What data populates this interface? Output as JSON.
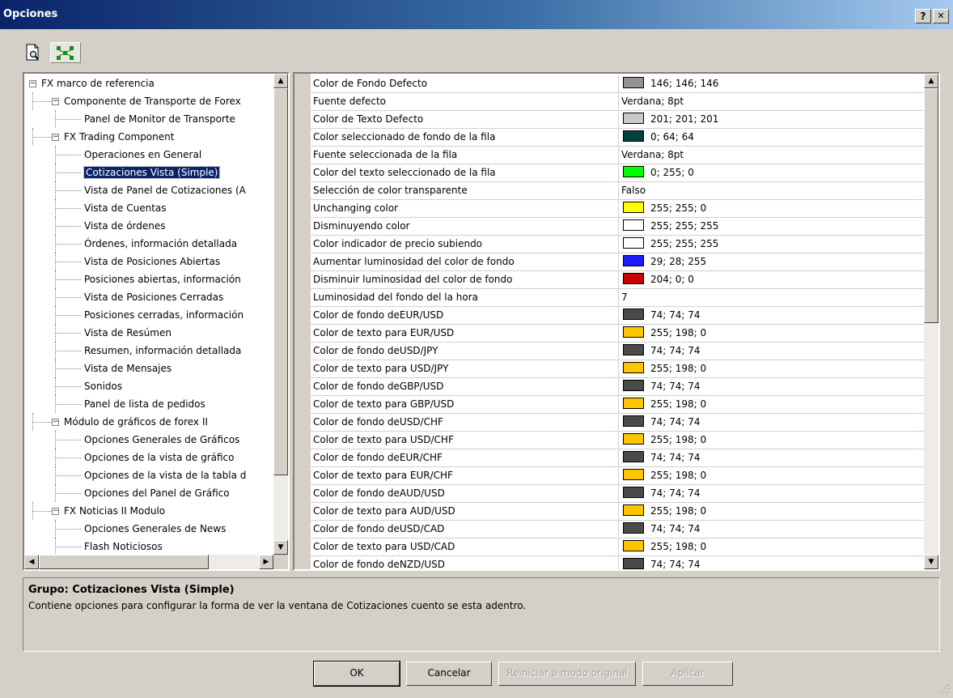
{
  "window": {
    "title": "Opciones",
    "help_btn": "?",
    "close_btn": "✕"
  },
  "tree": {
    "items": [
      {
        "label": "FX  marco de referencia",
        "level": 0,
        "expander": "−"
      },
      {
        "label": "Componente de Transporte de Forex",
        "level": 1,
        "expander": "−"
      },
      {
        "label": "Panel de Monitor de Transporte",
        "level": 2
      },
      {
        "label": "FX Trading Component",
        "level": 1,
        "expander": "−"
      },
      {
        "label": "Operaciones en General",
        "level": 2
      },
      {
        "label": "Cotizaciones Vista (Simple)",
        "level": 2,
        "selected": true
      },
      {
        "label": "Vista de Panel de Cotizaciones (A",
        "level": 2
      },
      {
        "label": "Vista de Cuentas",
        "level": 2
      },
      {
        "label": "Vista de órdenes",
        "level": 2
      },
      {
        "label": "Órdenes, información detallada",
        "level": 2
      },
      {
        "label": "Vista de Posiciones Abiertas",
        "level": 2
      },
      {
        "label": "Posiciones abiertas, información",
        "level": 2
      },
      {
        "label": "Vista de Posiciones Cerradas",
        "level": 2
      },
      {
        "label": "Posiciones cerradas, información",
        "level": 2
      },
      {
        "label": "Vista de Resúmen",
        "level": 2
      },
      {
        "label": "Resumen, información detallada",
        "level": 2
      },
      {
        "label": "Vista de Mensajes",
        "level": 2
      },
      {
        "label": "Sonidos",
        "level": 2
      },
      {
        "label": "Panel de lista de pedidos",
        "level": 2
      },
      {
        "label": "Módulo de gráficos de forex II",
        "level": 1,
        "expander": "−"
      },
      {
        "label": "Opciones Generales de Gráficos",
        "level": 2
      },
      {
        "label": "Opciones de la vista de gráfico",
        "level": 2
      },
      {
        "label": "Opciones de la vista de la tabla d",
        "level": 2
      },
      {
        "label": "Opciones del Panel de Gráfico",
        "level": 2
      },
      {
        "label": "FX Noticias II Modulo",
        "level": 1,
        "expander": "−"
      },
      {
        "label": "Opciones Generales de News",
        "level": 2
      },
      {
        "label": "Flash Noticiosos",
        "level": 2
      }
    ]
  },
  "properties": [
    {
      "name": "Color de Fondo Defecto",
      "value": "146; 146; 146",
      "color": "#929292"
    },
    {
      "name": "Fuente defecto",
      "value": "Verdana; 8pt"
    },
    {
      "name": "Color de Texto Defecto",
      "value": "201; 201; 201",
      "color": "#c9c9c9"
    },
    {
      "name": "Color seleccionado de fondo de la fila",
      "value": "0; 64; 64",
      "color": "#004040"
    },
    {
      "name": "Fuente seleccionada de la fila",
      "value": "Verdana; 8pt"
    },
    {
      "name": "Color del texto seleccionado de la fila",
      "value": "0; 255; 0",
      "color": "#00ff00"
    },
    {
      "name": "Selección de color transparente",
      "value": "Falso"
    },
    {
      "name": "Unchanging color",
      "value": "255; 255; 0",
      "color": "#ffff00"
    },
    {
      "name": "Disminuyendo color",
      "value": "255; 255; 255",
      "color": "#ffffff"
    },
    {
      "name": "Color indicador de precio subiendo",
      "value": "255; 255; 255",
      "color": "#ffffff"
    },
    {
      "name": "Aumentar luminosidad del color de fondo",
      "value": "29; 28; 255",
      "color": "#1d1cff"
    },
    {
      "name": "Disminuir luminosidad del color de fondo",
      "value": "204; 0; 0",
      "color": "#cc0000"
    },
    {
      "name": "Luminosidad del fondo del la hora",
      "value": "7"
    },
    {
      "name": "Color de fondo deEUR/USD",
      "value": "74; 74; 74",
      "color": "#4a4a4a"
    },
    {
      "name": "Color de texto para EUR/USD",
      "value": "255; 198; 0",
      "color": "#ffc600"
    },
    {
      "name": "Color de fondo deUSD/JPY",
      "value": "74; 74; 74",
      "color": "#4a4a4a"
    },
    {
      "name": "Color de texto para USD/JPY",
      "value": "255; 198; 0",
      "color": "#ffc600"
    },
    {
      "name": "Color de fondo deGBP/USD",
      "value": "74; 74; 74",
      "color": "#4a4a4a"
    },
    {
      "name": "Color de texto para GBP/USD",
      "value": "255; 198; 0",
      "color": "#ffc600"
    },
    {
      "name": "Color de fondo deUSD/CHF",
      "value": "74; 74; 74",
      "color": "#4a4a4a"
    },
    {
      "name": "Color de texto para USD/CHF",
      "value": "255; 198; 0",
      "color": "#ffc600"
    },
    {
      "name": "Color de fondo deEUR/CHF",
      "value": "74; 74; 74",
      "color": "#4a4a4a"
    },
    {
      "name": "Color de texto para EUR/CHF",
      "value": "255; 198; 0",
      "color": "#ffc600"
    },
    {
      "name": "Color de fondo deAUD/USD",
      "value": "74; 74; 74",
      "color": "#4a4a4a"
    },
    {
      "name": "Color de texto para AUD/USD",
      "value": "255; 198; 0",
      "color": "#ffc600"
    },
    {
      "name": "Color de fondo deUSD/CAD",
      "value": "74; 74; 74",
      "color": "#4a4a4a"
    },
    {
      "name": "Color de texto para USD/CAD",
      "value": "255; 198; 0",
      "color": "#ffc600"
    },
    {
      "name": "Color de fondo deNZD/USD",
      "value": "74; 74; 74",
      "color": "#4a4a4a"
    }
  ],
  "description": {
    "title": "Grupo: Cotizaciones Vista (Simple)",
    "text": "Contiene opciones para configurar la forma de ver la ventana de Cotizaciones cuento se esta adentro."
  },
  "buttons": {
    "ok": "OK",
    "cancel": "Cancelar",
    "reset": "Reiniciar a modo original",
    "apply": "Aplicar"
  },
  "icons": {
    "preview": "page-magnifier-icon",
    "tree": "tree-structure-icon"
  }
}
